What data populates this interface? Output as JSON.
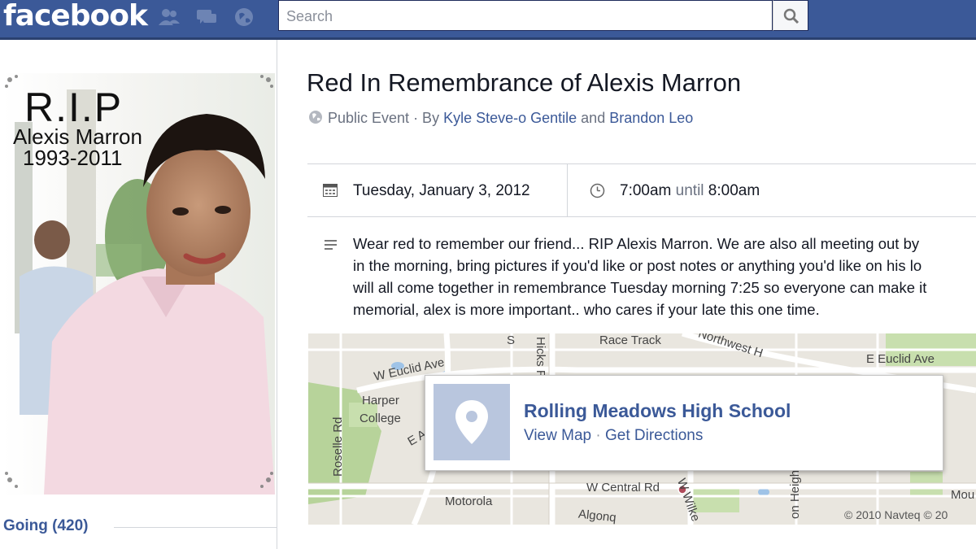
{
  "header": {
    "logo": "facebook",
    "search_placeholder": "Search",
    "icons": [
      "friend-requests-icon",
      "messages-icon",
      "notifications-icon",
      "search-icon"
    ]
  },
  "profile_image": {
    "rip_text": "R.I.P",
    "name": "Alexis Marron",
    "years": "1993-2011"
  },
  "attendance": {
    "going_label": "Going (420)"
  },
  "event": {
    "title": "Red In Remembrance of Alexis Marron",
    "privacy": "Public Event",
    "by_sep": " · By ",
    "host1": "Kyle Steve-o Gentile",
    "and_text": " and ",
    "host2": "Brandon Leo",
    "date": "Tuesday, January 3, 2012",
    "time_start": "7:00am",
    "time_until": " until ",
    "time_end": "8:00am",
    "description_lines": [
      "Wear red to remember our friend... RIP Alexis Marron. We are also all meeting out by",
      "in the morning, bring pictures if you'd like or post notes or anything you'd like on his lo",
      "will all come together in remembrance Tuesday morning 7:25 so everyone can make it",
      "memorial, alex is more important.. who cares if your late this one time."
    ]
  },
  "map": {
    "labels": {
      "race_track": "Race Track",
      "northwest": "Northwest H",
      "e_euclid": "E Euclid Ave",
      "w_euclid": "W Euclid Ave",
      "harper": "Harper",
      "college": "College",
      "e_a": "E A",
      "roselle": "Roselle Rd",
      "motorola": "Motorola",
      "algonq": "Algonq",
      "w_central": "W Central Rd",
      "wilke": "W Wilke",
      "heigh": "on Heigh",
      "mou": "Mou",
      "hicks": "Hicks R",
      "s_letter": "S"
    },
    "location_name": "Rolling Meadows High School",
    "view_map": "View Map",
    "link_sep": " · ",
    "get_directions": "Get Directions",
    "copyright": "© 2010 Navteq © 20"
  },
  "colors": {
    "brand": "#3b5998",
    "link": "#3b5998",
    "muted": "#6a7180"
  }
}
